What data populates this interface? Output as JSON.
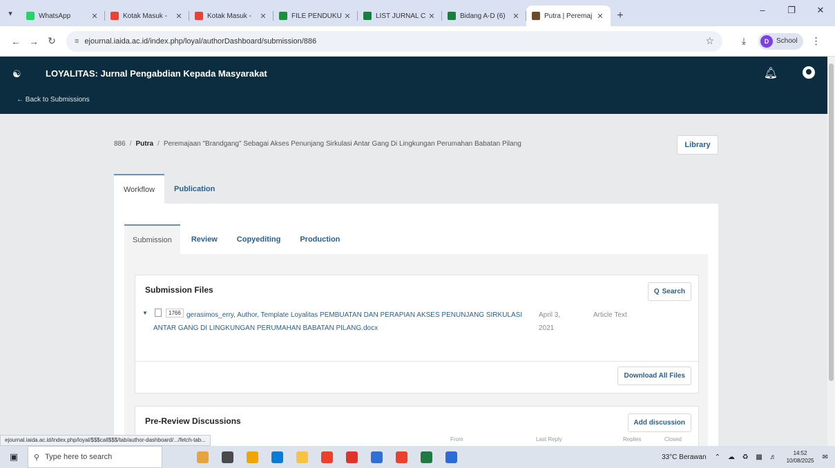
{
  "browser": {
    "tabs": [
      {
        "label": "WhatsApp",
        "color": "#25d366",
        "active": false
      },
      {
        "label": "Kotak Masuk - ",
        "color": "#ea4335",
        "active": false
      },
      {
        "label": "Kotak Masuk - ",
        "color": "#ea4335",
        "active": false
      },
      {
        "label": "FILE PENDUKU",
        "color": "#1e8e3e",
        "active": false
      },
      {
        "label": "LIST JURNAL C",
        "color": "#188038",
        "active": false
      },
      {
        "label": "Bidang A-D (6)",
        "color": "#188038",
        "active": false
      },
      {
        "label": "Putra | Peremaj",
        "color": "#6b4c2a",
        "active": true
      }
    ],
    "url": "ejournal.iaida.ac.id/index.php/loyal/authorDashboard/submission/886",
    "profile_label": "School",
    "profile_initial": "D",
    "status_url": "ejournal.iaida.ac.id/index.php/loyal/$$$call$$$/tab/author-dashboard/.../fetch-tab..."
  },
  "site": {
    "title": "LOYALITAS: Jurnal Pengabdian Kepada Masyarakat",
    "back_link": "← Back to Submissions"
  },
  "breadcrumb": {
    "id": "886",
    "author": "Putra",
    "title": "Peremajaan \"Brandgang\" Sebagai Akses Penunjang Sirkulasi Antar Gang Di Lingkungan Perumahan Babatan Pilang"
  },
  "library_label": "Library",
  "main_tabs": [
    {
      "label": "Workflow",
      "active": true
    },
    {
      "label": "Publication",
      "active": false
    }
  ],
  "workflow_tabs": [
    {
      "label": "Submission",
      "active": true
    },
    {
      "label": "Review",
      "active": false
    },
    {
      "label": "Copyediting",
      "active": false
    },
    {
      "label": "Production",
      "active": false
    }
  ],
  "submission_files": {
    "title": "Submission Files",
    "search_label": "Search",
    "files": [
      {
        "id": "1766",
        "name": "gerasimos_erry, Author, Template Loyalitas PEMBUATAN DAN PERAPIAN AKSES PENUNJANG SIRKULASI ANTAR GANG DI LINGKUNGAN PERUMAHAN BABATAN PILANG.docx",
        "date": "April 3, 2021",
        "type": "Article Text"
      }
    ],
    "download_all_label": "Download All Files"
  },
  "pre_review": {
    "title": "Pre-Review Discussions",
    "add_label": "Add discussion",
    "columns": [
      "From",
      "Last Reply",
      "Replies",
      "Closed"
    ]
  },
  "taskbar": {
    "search_placeholder": "Type here to search",
    "apps": [
      "#e8a33a",
      "#4a4a4a",
      "#f0a500",
      "#0b7bd4",
      "#f6c343",
      "#e8412c",
      "#e0332a",
      "#2f6fd6",
      "#e8412c",
      "#1e7a3e",
      "#2b6bd6"
    ],
    "weather": "33°C Berawan",
    "time": "14:52",
    "date": "10/08/2025"
  }
}
